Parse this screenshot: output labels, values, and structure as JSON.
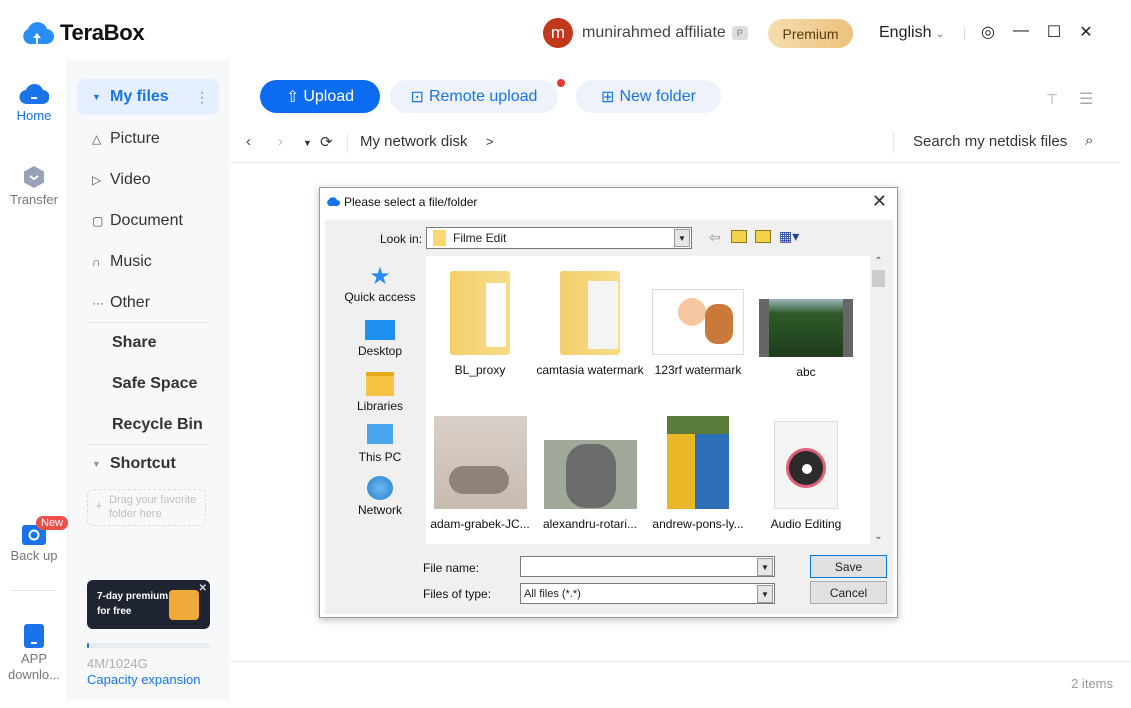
{
  "app": {
    "name": "TeraBox",
    "user": {
      "avatar_letter": "m",
      "name": "munirahmed affiliate",
      "badge": "P"
    },
    "premium_label": "Premium",
    "language": "English",
    "window_controls": {
      "settings": "◎",
      "minimize": "—",
      "maximize": "☐",
      "close": "✕"
    }
  },
  "rail": {
    "items": [
      {
        "label": "Home",
        "icon": "cloud-home-icon",
        "active": true
      },
      {
        "label": "Transfer",
        "icon": "transfer-icon"
      },
      {
        "label": "Back up",
        "icon": "backup-icon",
        "badge": "New"
      },
      {
        "label": "APP downlo...",
        "icon": "app-download-icon"
      }
    ]
  },
  "sidenav": {
    "my_files": "My files",
    "categories": [
      {
        "label": "Picture",
        "icon": "△"
      },
      {
        "label": "Video",
        "icon": "▷"
      },
      {
        "label": "Document",
        "icon": "▢"
      },
      {
        "label": "Music",
        "icon": "∩"
      },
      {
        "label": "Other",
        "icon": "···"
      }
    ],
    "sections": [
      "Share",
      "Safe Space",
      "Recycle Bin"
    ],
    "shortcut": "Shortcut",
    "drop_hint_line1": "Drag your favorite",
    "drop_hint_line2": "folder here",
    "promo_line1": "7-day premium",
    "promo_line2": "for free",
    "storage": {
      "used_text": "4M/1024G",
      "used_fraction": 0.01
    },
    "capacity_link": "Capacity expansion"
  },
  "toolbar": {
    "upload": "Upload",
    "remote_upload": "Remote upload",
    "new_folder": "New folder"
  },
  "navbar": {
    "breadcrumb": "My network disk",
    "breadcrumb_sep": ">",
    "search_placeholder": "Search my netdisk files"
  },
  "status": {
    "items": "2 items"
  },
  "dialog": {
    "title": "Please select a file/folder",
    "look_in_label": "Look in:",
    "look_in_value": "Filme Edit",
    "places": [
      "Quick access",
      "Desktop",
      "Libraries",
      "This PC",
      "Network"
    ],
    "files": [
      {
        "name": "BL_proxy",
        "type": "folder"
      },
      {
        "name": "camtasia watermark",
        "type": "folder"
      },
      {
        "name": "123rf watermark",
        "type": "image"
      },
      {
        "name": "abc",
        "type": "video"
      },
      {
        "name": "adam-grabek-JC...",
        "type": "image"
      },
      {
        "name": "alexandru-rotari...",
        "type": "image"
      },
      {
        "name": "andrew-pons-ly...",
        "type": "image"
      },
      {
        "name": "Audio Editing",
        "type": "audio"
      }
    ],
    "file_name_label": "File name:",
    "file_name_value": "",
    "file_type_label": "Files of type:",
    "file_type_value": "All files (*.*)",
    "save": "Save",
    "cancel": "Cancel"
  }
}
